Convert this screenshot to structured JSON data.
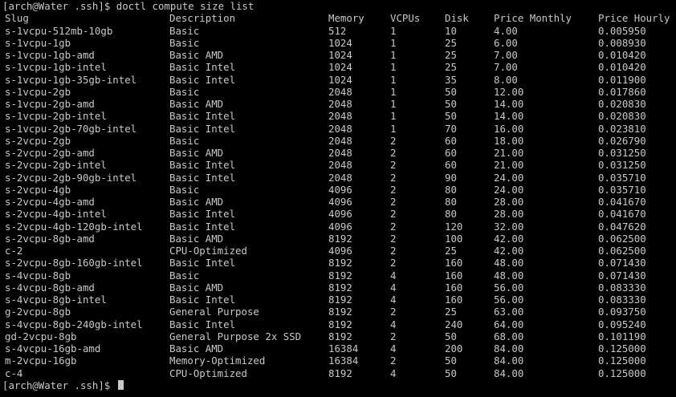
{
  "terminal": {
    "prompt_top": "[arch@Water .ssh]$ ",
    "command": "doctl compute size list",
    "prompt_bottom": "[arch@Water .ssh]$ ",
    "headers": {
      "slug": "Slug",
      "description": "Description",
      "memory": "Memory",
      "vcpus": "VCPUs",
      "disk": "Disk",
      "price_monthly": "Price Monthly",
      "price_hourly": "Price Hourly"
    },
    "rows": [
      {
        "slug": "s-1vcpu-512mb-10gb",
        "description": "Basic",
        "memory": "512",
        "vcpus": "1",
        "disk": "10",
        "price_monthly": "4.00",
        "price_hourly": "0.005950"
      },
      {
        "slug": "s-1vcpu-1gb",
        "description": "Basic",
        "memory": "1024",
        "vcpus": "1",
        "disk": "25",
        "price_monthly": "6.00",
        "price_hourly": "0.008930"
      },
      {
        "slug": "s-1vcpu-1gb-amd",
        "description": "Basic AMD",
        "memory": "1024",
        "vcpus": "1",
        "disk": "25",
        "price_monthly": "7.00",
        "price_hourly": "0.010420"
      },
      {
        "slug": "s-1vcpu-1gb-intel",
        "description": "Basic Intel",
        "memory": "1024",
        "vcpus": "1",
        "disk": "25",
        "price_monthly": "7.00",
        "price_hourly": "0.010420"
      },
      {
        "slug": "s-1vcpu-1gb-35gb-intel",
        "description": "Basic Intel",
        "memory": "1024",
        "vcpus": "1",
        "disk": "35",
        "price_monthly": "8.00",
        "price_hourly": "0.011900"
      },
      {
        "slug": "s-1vcpu-2gb",
        "description": "Basic",
        "memory": "2048",
        "vcpus": "1",
        "disk": "50",
        "price_monthly": "12.00",
        "price_hourly": "0.017860"
      },
      {
        "slug": "s-1vcpu-2gb-amd",
        "description": "Basic AMD",
        "memory": "2048",
        "vcpus": "1",
        "disk": "50",
        "price_monthly": "14.00",
        "price_hourly": "0.020830"
      },
      {
        "slug": "s-1vcpu-2gb-intel",
        "description": "Basic Intel",
        "memory": "2048",
        "vcpus": "1",
        "disk": "50",
        "price_monthly": "14.00",
        "price_hourly": "0.020830"
      },
      {
        "slug": "s-1vcpu-2gb-70gb-intel",
        "description": "Basic Intel",
        "memory": "2048",
        "vcpus": "1",
        "disk": "70",
        "price_monthly": "16.00",
        "price_hourly": "0.023810"
      },
      {
        "slug": "s-2vcpu-2gb",
        "description": "Basic",
        "memory": "2048",
        "vcpus": "2",
        "disk": "60",
        "price_monthly": "18.00",
        "price_hourly": "0.026790"
      },
      {
        "slug": "s-2vcpu-2gb-amd",
        "description": "Basic AMD",
        "memory": "2048",
        "vcpus": "2",
        "disk": "60",
        "price_monthly": "21.00",
        "price_hourly": "0.031250"
      },
      {
        "slug": "s-2vcpu-2gb-intel",
        "description": "Basic Intel",
        "memory": "2048",
        "vcpus": "2",
        "disk": "60",
        "price_monthly": "21.00",
        "price_hourly": "0.031250"
      },
      {
        "slug": "s-2vcpu-2gb-90gb-intel",
        "description": "Basic Intel",
        "memory": "2048",
        "vcpus": "2",
        "disk": "90",
        "price_monthly": "24.00",
        "price_hourly": "0.035710"
      },
      {
        "slug": "s-2vcpu-4gb",
        "description": "Basic",
        "memory": "4096",
        "vcpus": "2",
        "disk": "80",
        "price_monthly": "24.00",
        "price_hourly": "0.035710"
      },
      {
        "slug": "s-2vcpu-4gb-amd",
        "description": "Basic AMD",
        "memory": "4096",
        "vcpus": "2",
        "disk": "80",
        "price_monthly": "28.00",
        "price_hourly": "0.041670"
      },
      {
        "slug": "s-2vcpu-4gb-intel",
        "description": "Basic Intel",
        "memory": "4096",
        "vcpus": "2",
        "disk": "80",
        "price_monthly": "28.00",
        "price_hourly": "0.041670"
      },
      {
        "slug": "s-2vcpu-4gb-120gb-intel",
        "description": "Basic Intel",
        "memory": "4096",
        "vcpus": "2",
        "disk": "120",
        "price_monthly": "32.00",
        "price_hourly": "0.047620"
      },
      {
        "slug": "s-2vcpu-8gb-amd",
        "description": "Basic AMD",
        "memory": "8192",
        "vcpus": "2",
        "disk": "100",
        "price_monthly": "42.00",
        "price_hourly": "0.062500"
      },
      {
        "slug": "c-2",
        "description": "CPU-Optimized",
        "memory": "4096",
        "vcpus": "2",
        "disk": "25",
        "price_monthly": "42.00",
        "price_hourly": "0.062500"
      },
      {
        "slug": "s-2vcpu-8gb-160gb-intel",
        "description": "Basic Intel",
        "memory": "8192",
        "vcpus": "2",
        "disk": "160",
        "price_monthly": "48.00",
        "price_hourly": "0.071430"
      },
      {
        "slug": "s-4vcpu-8gb",
        "description": "Basic",
        "memory": "8192",
        "vcpus": "4",
        "disk": "160",
        "price_monthly": "48.00",
        "price_hourly": "0.071430"
      },
      {
        "slug": "s-4vcpu-8gb-amd",
        "description": "Basic AMD",
        "memory": "8192",
        "vcpus": "4",
        "disk": "160",
        "price_monthly": "56.00",
        "price_hourly": "0.083330"
      },
      {
        "slug": "s-4vcpu-8gb-intel",
        "description": "Basic Intel",
        "memory": "8192",
        "vcpus": "4",
        "disk": "160",
        "price_monthly": "56.00",
        "price_hourly": "0.083330"
      },
      {
        "slug": "g-2vcpu-8gb",
        "description": "General Purpose",
        "memory": "8192",
        "vcpus": "2",
        "disk": "25",
        "price_monthly": "63.00",
        "price_hourly": "0.093750"
      },
      {
        "slug": "s-4vcpu-8gb-240gb-intel",
        "description": "Basic Intel",
        "memory": "8192",
        "vcpus": "4",
        "disk": "240",
        "price_monthly": "64.00",
        "price_hourly": "0.095240"
      },
      {
        "slug": "gd-2vcpu-8gb",
        "description": "General Purpose 2x SSD",
        "memory": "8192",
        "vcpus": "2",
        "disk": "50",
        "price_monthly": "68.00",
        "price_hourly": "0.101190"
      },
      {
        "slug": "s-4vcpu-16gb-amd",
        "description": "Basic AMD",
        "memory": "16384",
        "vcpus": "4",
        "disk": "200",
        "price_monthly": "84.00",
        "price_hourly": "0.125000"
      },
      {
        "slug": "m-2vcpu-16gb",
        "description": "Memory-Optimized",
        "memory": "16384",
        "vcpus": "2",
        "disk": "50",
        "price_monthly": "84.00",
        "price_hourly": "0.125000"
      },
      {
        "slug": "c-4",
        "description": "CPU-Optimized",
        "memory": "8192",
        "vcpus": "4",
        "disk": "50",
        "price_monthly": "84.00",
        "price_hourly": "0.125000"
      }
    ]
  }
}
